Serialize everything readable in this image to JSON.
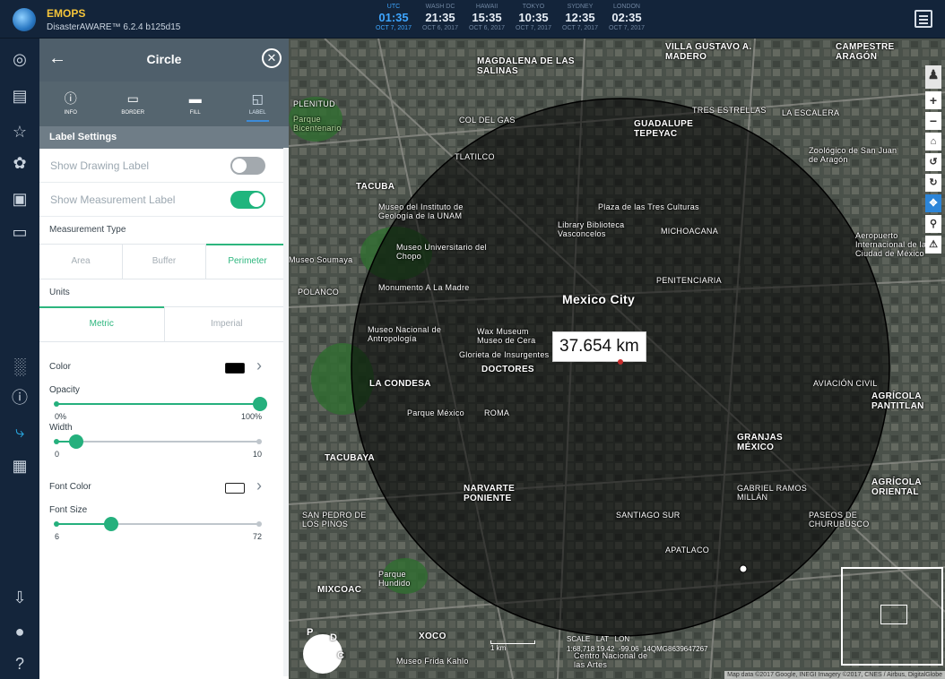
{
  "app": {
    "title": "EMOPS",
    "version": "DisasterAWARE™ 6.2.4 b125d15"
  },
  "clocks": [
    {
      "zone": "UTC",
      "time": "01:35",
      "date": "OCT 7, 2017",
      "active": true
    },
    {
      "zone": "WASH DC",
      "time": "21:35",
      "date": "OCT 6, 2017"
    },
    {
      "zone": "HAWAII",
      "time": "15:35",
      "date": "OCT 6, 2017"
    },
    {
      "zone": "TOKYO",
      "time": "10:35",
      "date": "OCT 7, 2017"
    },
    {
      "zone": "SYDNEY",
      "time": "12:35",
      "date": "OCT 7, 2017"
    },
    {
      "zone": "LONDON",
      "time": "02:35",
      "date": "OCT 7, 2017"
    }
  ],
  "panel": {
    "title": "Circle",
    "tabs": [
      {
        "label": "INFO",
        "icon": "info-icon"
      },
      {
        "label": "BORDER",
        "icon": "border-icon"
      },
      {
        "label": "FILL",
        "icon": "fill-icon"
      },
      {
        "label": "LABEL",
        "icon": "label-icon",
        "active": true
      }
    ],
    "section": "Label Settings",
    "show_drawing_label": {
      "label": "Show Drawing Label",
      "on": false
    },
    "show_measurement_label": {
      "label": "Show Measurement Label",
      "on": true
    },
    "measurement_type": {
      "label": "Measurement Type",
      "options": [
        "Area",
        "Buffer",
        "Perimeter"
      ],
      "selected": "Perimeter"
    },
    "units": {
      "label": "Units",
      "options": [
        "Metric",
        "Imperial"
      ],
      "selected": "Metric"
    },
    "color": {
      "label": "Color",
      "value": "#000000"
    },
    "opacity": {
      "label": "Opacity",
      "min": "0%",
      "max": "100%",
      "value": 1.0
    },
    "width": {
      "label": "Width",
      "min": "0",
      "max": "10",
      "value": 1
    },
    "font_color": {
      "label": "Font Color",
      "value": "#ffffff"
    },
    "font_size": {
      "label": "Font Size",
      "min": "6",
      "max": "72",
      "value": 24
    }
  },
  "map": {
    "measurement": "37.654 km",
    "labels": [
      "Mexico City",
      "MAGDALENA DE LAS SALINAS",
      "VILLA GUSTAVO A. MADERO",
      "CAMPESTRE ARAGÓN",
      "GUADALUPE TEPEYAC",
      "TRES ESTRELLAS",
      "LA ESCALERA",
      "Zoológico de San Juan de Aragón",
      "TACUBA",
      "Museo del Instituto de Geología de la UNAM",
      "Plaza de las Tres Culturas",
      "Library Biblioteca Vasconcelos",
      "MICHOACANA",
      "Aeropuerto Internacional de la Ciudad de México",
      "Museo Universitario del Chopo",
      "Museo Soumaya",
      "POLANCO",
      "Monumento A La Madre",
      "PENITENCIARIA",
      "Museo Nacional de Antropología",
      "Wax Museum Museo de Cera",
      "Glorieta de Insurgentes",
      "DOCTORES",
      "LA CONDESA",
      "Parque México",
      "ROMA",
      "AVIACIÓN CIVIL",
      "AGRÍCOLA PANTITLAN",
      "TACUBAYA",
      "GRANJAS MÉXICO",
      "NARVARTE PONIENTE",
      "GABRIEL RAMOS MILLÁN",
      "AGRÍCOLA ORIENTAL",
      "SAN PEDRO DE LOS PINOS",
      "SANTIAGO SUR",
      "APATLACO",
      "PASEOS DE CHURUBUSCO",
      "MIXCOAC",
      "XOCO",
      "Museo Frida Kahlo",
      "Centro Nacional de las Artes",
      "Parque Hundido",
      "COL DEL GAS",
      "TLATILCO",
      "PLENITUD",
      "Parque Bicentenario"
    ],
    "scale": {
      "label": "SCALE",
      "value": "1 km"
    },
    "coords": {
      "lat_label": "LAT",
      "lon_label": "LON",
      "lat": "1:68,718   19.42",
      "lon": "-99.06",
      "mgrs": "14QMG8639647267"
    },
    "attribution": "Map data ©2017 Google, INEGI Imagery ©2017, CNES / Airbus, DigitalGlobe",
    "compass": {
      "n": "P",
      "e": "D",
      "s": "C"
    }
  },
  "colors": {
    "accent": "#1fb57d",
    "topbar": "#13243a",
    "panel_header": "#4f5f6b",
    "utc": "#3ea6ff",
    "brand": "#f5c53a"
  },
  "rail_icons": [
    "layers-icon",
    "stack-icon",
    "star-icon",
    "twitter-icon",
    "tv-icon",
    "cards-icon",
    "chart-icon",
    "info-icon",
    "draw-icon",
    "buildings-icon",
    "download-icon",
    "bulb-icon",
    "help-icon"
  ]
}
